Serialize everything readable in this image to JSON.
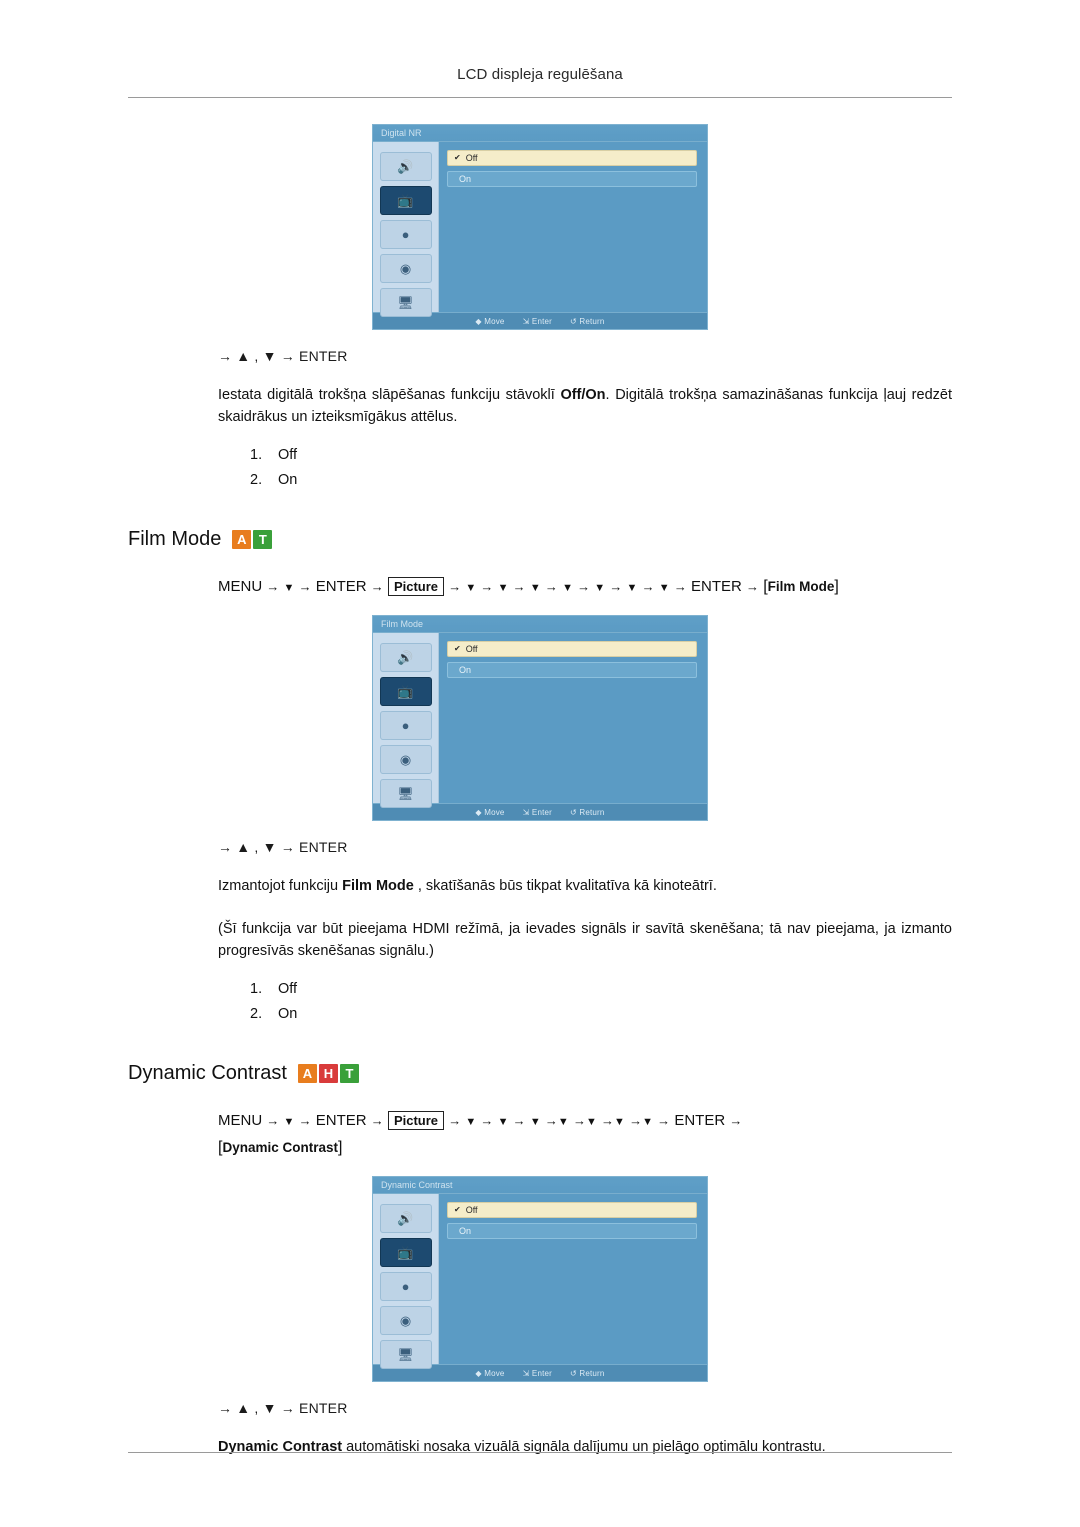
{
  "header": {
    "title": "LCD displeja regulēšana"
  },
  "osd": {
    "footer": {
      "move": "Move",
      "enter": "Enter",
      "return": "Return"
    },
    "icons": [
      "sound-icon",
      "picture-icon",
      "setup-icon",
      "settings-icon",
      "multi-control-icon"
    ],
    "blocks": [
      {
        "title": "Digital NR",
        "selected_icon_index": 1,
        "items": [
          {
            "label": "Off",
            "state": "highlight",
            "check": "✔"
          },
          {
            "label": "On",
            "state": "plain",
            "check": ""
          }
        ]
      },
      {
        "title": "Film Mode",
        "selected_icon_index": 1,
        "items": [
          {
            "label": "Off",
            "state": "highlight",
            "check": "✔"
          },
          {
            "label": "On",
            "state": "plain",
            "check": ""
          }
        ]
      },
      {
        "title": "Dynamic Contrast",
        "selected_icon_index": 1,
        "items": [
          {
            "label": "Off",
            "state": "highlight",
            "check": "✔"
          },
          {
            "label": "On",
            "state": "plain",
            "check": ""
          }
        ]
      }
    ]
  },
  "sections": [
    {
      "key_hint": "→ ▲ , ▼ → ENTER",
      "paragraph_pre": "Iestata digitālā trokšņa slāpēšanas funkciju stāvoklī ",
      "paragraph_bold": "Off/On",
      "paragraph_post": ". Digitālā trokšņa samazināšanas funkcija ļauj redzēt skaidrākus un izteiksmīgākus attēlus.",
      "options": [
        {
          "num": "1.",
          "label": "Off"
        },
        {
          "num": "2.",
          "label": "On"
        }
      ]
    }
  ],
  "film_mode": {
    "title": "Film Mode",
    "badges": [
      "A",
      "T"
    ],
    "menu_path": {
      "menu": "MENU",
      "enter": "ENTER",
      "picture": "Picture",
      "target": "Film Mode",
      "down_count_before_enter": 1,
      "down_count_to_item": 7
    },
    "key_hint": "→ ▲ , ▼ → ENTER",
    "paragraph1_pre": "Izmantojot funkciju  ",
    "paragraph1_bold": "Film Mode",
    "paragraph1_post": " , skatīšanās būs tikpat kvalitatīva kā kinoteātrī.",
    "paragraph2": "(Šī funkcija var būt pieejama HDMI režīmā, ja ievades signāls ir savītā skenēšana; tā nav pieejama, ja izmanto progresīvās skenēšanas signālu.)",
    "options": [
      {
        "num": "1.",
        "label": "Off"
      },
      {
        "num": "2.",
        "label": "On"
      }
    ]
  },
  "dynamic_contrast": {
    "title": "Dynamic Contrast",
    "badges": [
      "A",
      "H",
      "T"
    ],
    "menu_path": {
      "menu": "MENU",
      "enter": "ENTER",
      "picture": "Picture",
      "target": "Dynamic Contrast"
    },
    "key_hint": "→ ▲ , ▼ → ENTER",
    "paragraph_bold": "Dynamic Contrast",
    "paragraph_post": " automātiski nosaka vizuālā signāla dalījumu un pielāgo optimālu kontrastu."
  }
}
